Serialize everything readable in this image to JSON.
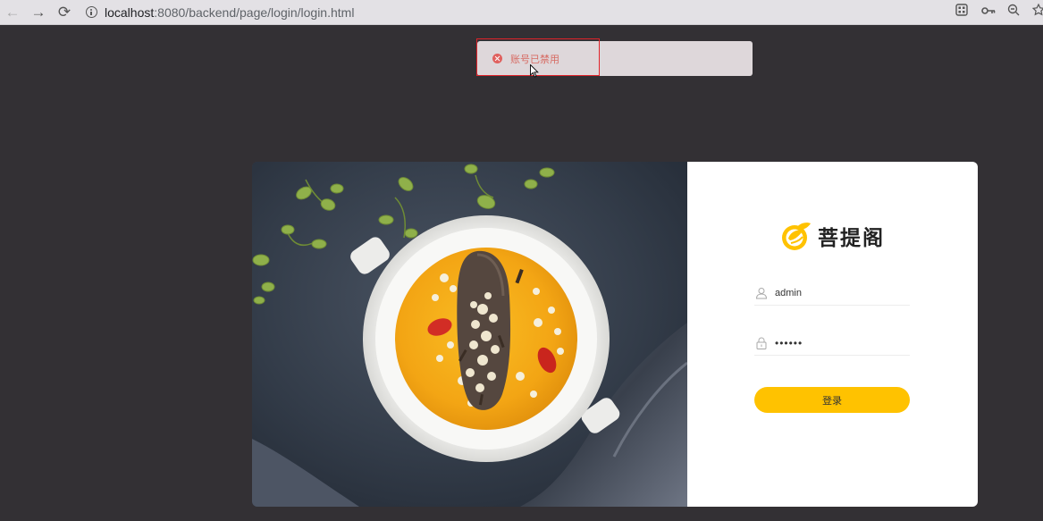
{
  "browser": {
    "back_icon": "back-arrow-icon",
    "forward_icon": "forward-arrow-icon",
    "reload_icon": "reload-icon",
    "url_host": "localhost",
    "url_rest": ":8080/backend/page/login/login.html",
    "right_icons": [
      "apps-grid-icon",
      "key-icon",
      "zoom-out-icon",
      "star-icon"
    ]
  },
  "toast": {
    "type": "error",
    "message": "账号已禁用",
    "color": "#d76b63"
  },
  "brand": {
    "name": "菩提阁",
    "accent": "#ffc200"
  },
  "form": {
    "username_value": "admin",
    "password_value": "••••••",
    "login_label": "登录"
  },
  "colors": {
    "background": "#333034",
    "button": "#ffc200"
  }
}
